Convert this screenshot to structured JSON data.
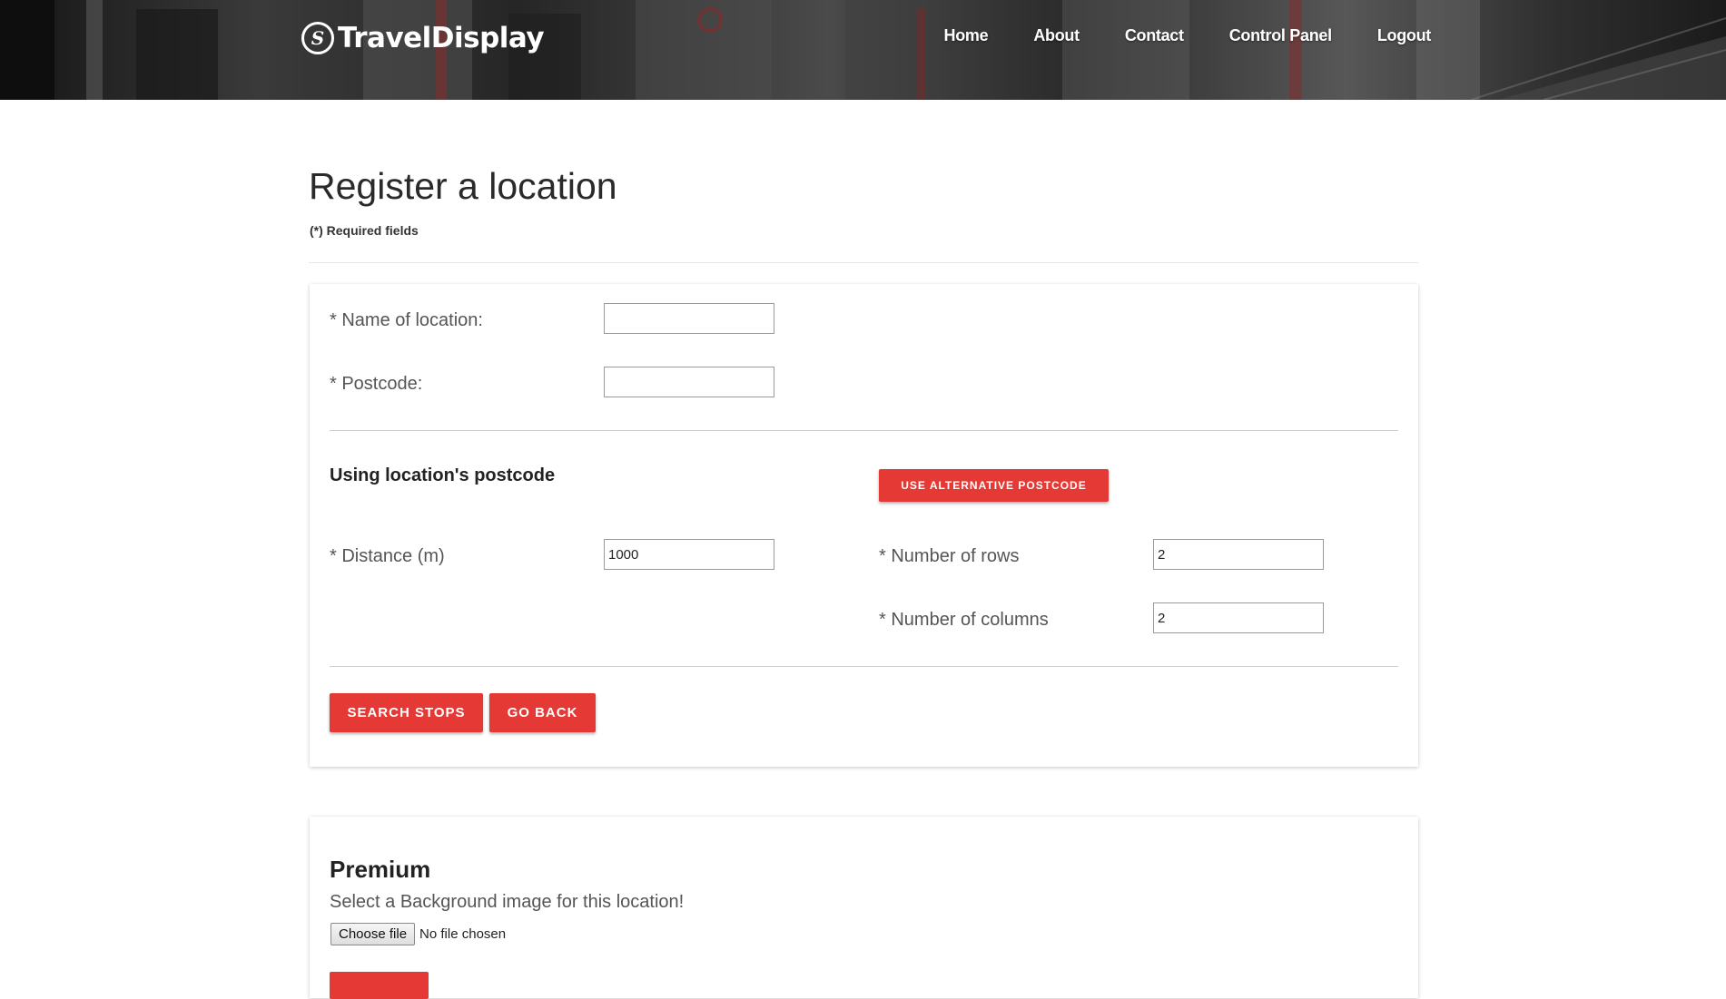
{
  "brand": {
    "name": "TravelDisplay",
    "logo_glyph": "S"
  },
  "nav": {
    "home": "Home",
    "about": "About",
    "contact": "Contact",
    "control_panel": "Control Panel",
    "logout": "Logout"
  },
  "page": {
    "title": "Register a location",
    "required_note": "(*) Required fields"
  },
  "form": {
    "name_label": "* Name of location:",
    "name_value": "",
    "postcode_label": "* Postcode:",
    "postcode_value": "",
    "postcode_mode_heading": "Using location's postcode",
    "alt_postcode_button": "Use alternative postcode",
    "distance_label": "* Distance (m)",
    "distance_value": "1000",
    "rows_label": "* Number of rows",
    "rows_value": "2",
    "columns_label": "* Number of columns",
    "columns_value": "2",
    "search_button": "Search stops",
    "back_button": "Go back"
  },
  "premium": {
    "title": "Premium",
    "description": "Select a Background image for this location!",
    "choose_file": "Choose file",
    "file_status": "No file chosen"
  },
  "colors": {
    "accent": "#e53935",
    "header_bg": "#2b2b2b",
    "text": "#333333"
  }
}
